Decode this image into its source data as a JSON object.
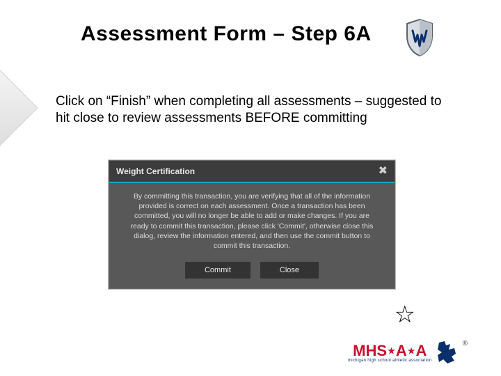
{
  "title": "Assessment Form – Step 6A",
  "instruction": "Click on “Finish” when completing all assessments – suggested to hit close to review assessments BEFORE committing",
  "modal": {
    "title": "Weight Certification",
    "body": "By committing this transaction, you are verifying that all of the information provided is correct on each assessment. Once a transaction has been committed, you will no longer be able to add or make changes. If you are ready to commit this transaction, please click 'Commit', otherwise close this dialog, review the information entered, and then use the commit button to commit this transaction.",
    "commit_label": "Commit",
    "close_label": "Close",
    "close_x": "✖"
  },
  "footer": {
    "brand": "MHS",
    "brand2": "A",
    "brand3": "A",
    "sub": "michigan high school athletic association",
    "reg": "®"
  },
  "icons": {
    "star": "☆"
  }
}
